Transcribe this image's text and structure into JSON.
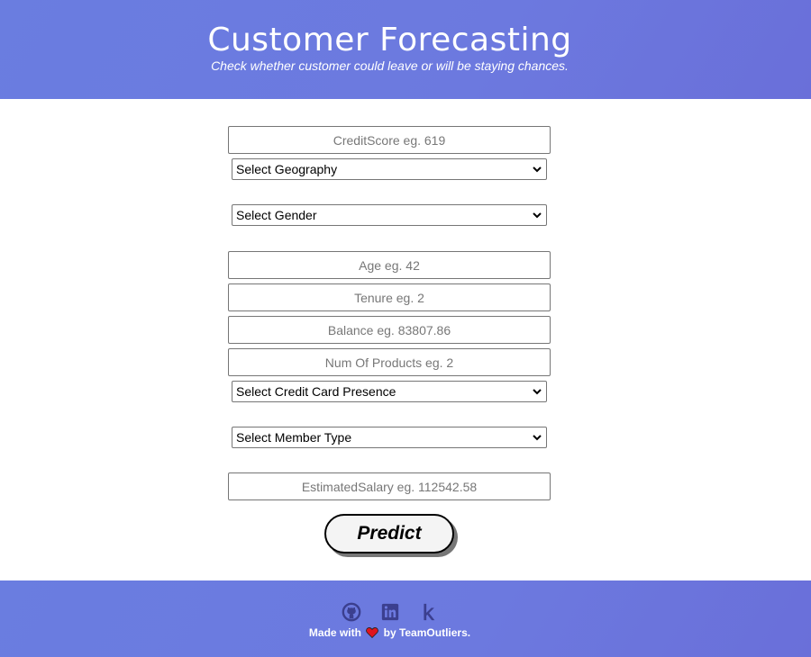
{
  "header": {
    "title": "Customer Forecasting",
    "subtitle": "Check whether customer could leave or will be staying chances."
  },
  "form": {
    "credit_score": {
      "placeholder": "CreditScore eg. 619",
      "value": ""
    },
    "geography": {
      "selected": "Select Geography"
    },
    "gender": {
      "selected": "Select Gender"
    },
    "age": {
      "placeholder": "Age eg. 42",
      "value": ""
    },
    "tenure": {
      "placeholder": "Tenure eg. 2",
      "value": ""
    },
    "balance": {
      "placeholder": "Balance eg. 83807.86",
      "value": ""
    },
    "num_products": {
      "placeholder": "Num Of Products eg. 2",
      "value": ""
    },
    "credit_card": {
      "selected": "Select Credit Card Presence"
    },
    "member_type": {
      "selected": "Select Member Type"
    },
    "estimated_salary": {
      "placeholder": "EstimatedSalary eg. 112542.58",
      "value": ""
    },
    "predict_label": "Predict"
  },
  "footer": {
    "icons": [
      "github-icon",
      "linkedin-icon",
      "kaggle-icon"
    ],
    "made_with": "Made with",
    "by": "by TeamOutliers."
  },
  "colors": {
    "banner": "#6a7de0",
    "icon": "#3b3f8f",
    "heart": "#e0141e"
  }
}
